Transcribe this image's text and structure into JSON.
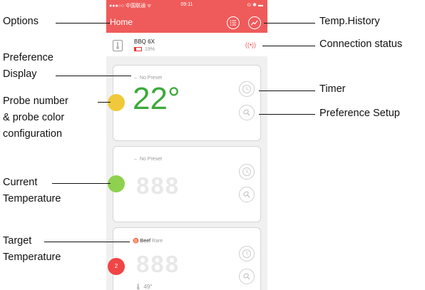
{
  "statusbar": {
    "carrier": "●●●○○ 中国联通 ᯤ",
    "time": "09:11",
    "right": "⊙ ✱ ▬"
  },
  "nav": {
    "title": "Home"
  },
  "device": {
    "name": "BBQ 6X",
    "battery": "19%"
  },
  "connection_icon": "wireless-signal-icon",
  "cards": [
    {
      "preset_dash": "–",
      "preset": "No Preset",
      "probe_color": "#f0c93a",
      "probe_number": "",
      "temperature": "22°",
      "temp_color": "#3caa3c"
    },
    {
      "preset_dash": "–",
      "preset": "No Preset",
      "probe_color": "#8fd14f",
      "probe_number": "",
      "temperature_placeholder": "888"
    },
    {
      "preset_icon": "bull-icon",
      "preset_meat": "Beef",
      "preset_doneness": "Rare",
      "probe_color": "#f04545",
      "probe_number": "2",
      "temperature_placeholder": "888",
      "sub_temp": "49°"
    }
  ],
  "labels": {
    "options": "Options",
    "preference_display_1": "Preference",
    "preference_display_2": "Display",
    "probe_config_1": "Probe number",
    "probe_config_2": "& probe color",
    "probe_config_3": "configuration",
    "current_temp_1": "Current",
    "current_temp_2": "Temperature",
    "target_temp_1": "Target",
    "target_temp_2": "Temperature",
    "temp_history": "Temp.History",
    "connection_status": "Connection status",
    "timer": "Timer",
    "preference_setup": "Preference Setup"
  },
  "colors": {
    "accent": "#ef5b5b",
    "temp_green": "#3caa3c"
  }
}
